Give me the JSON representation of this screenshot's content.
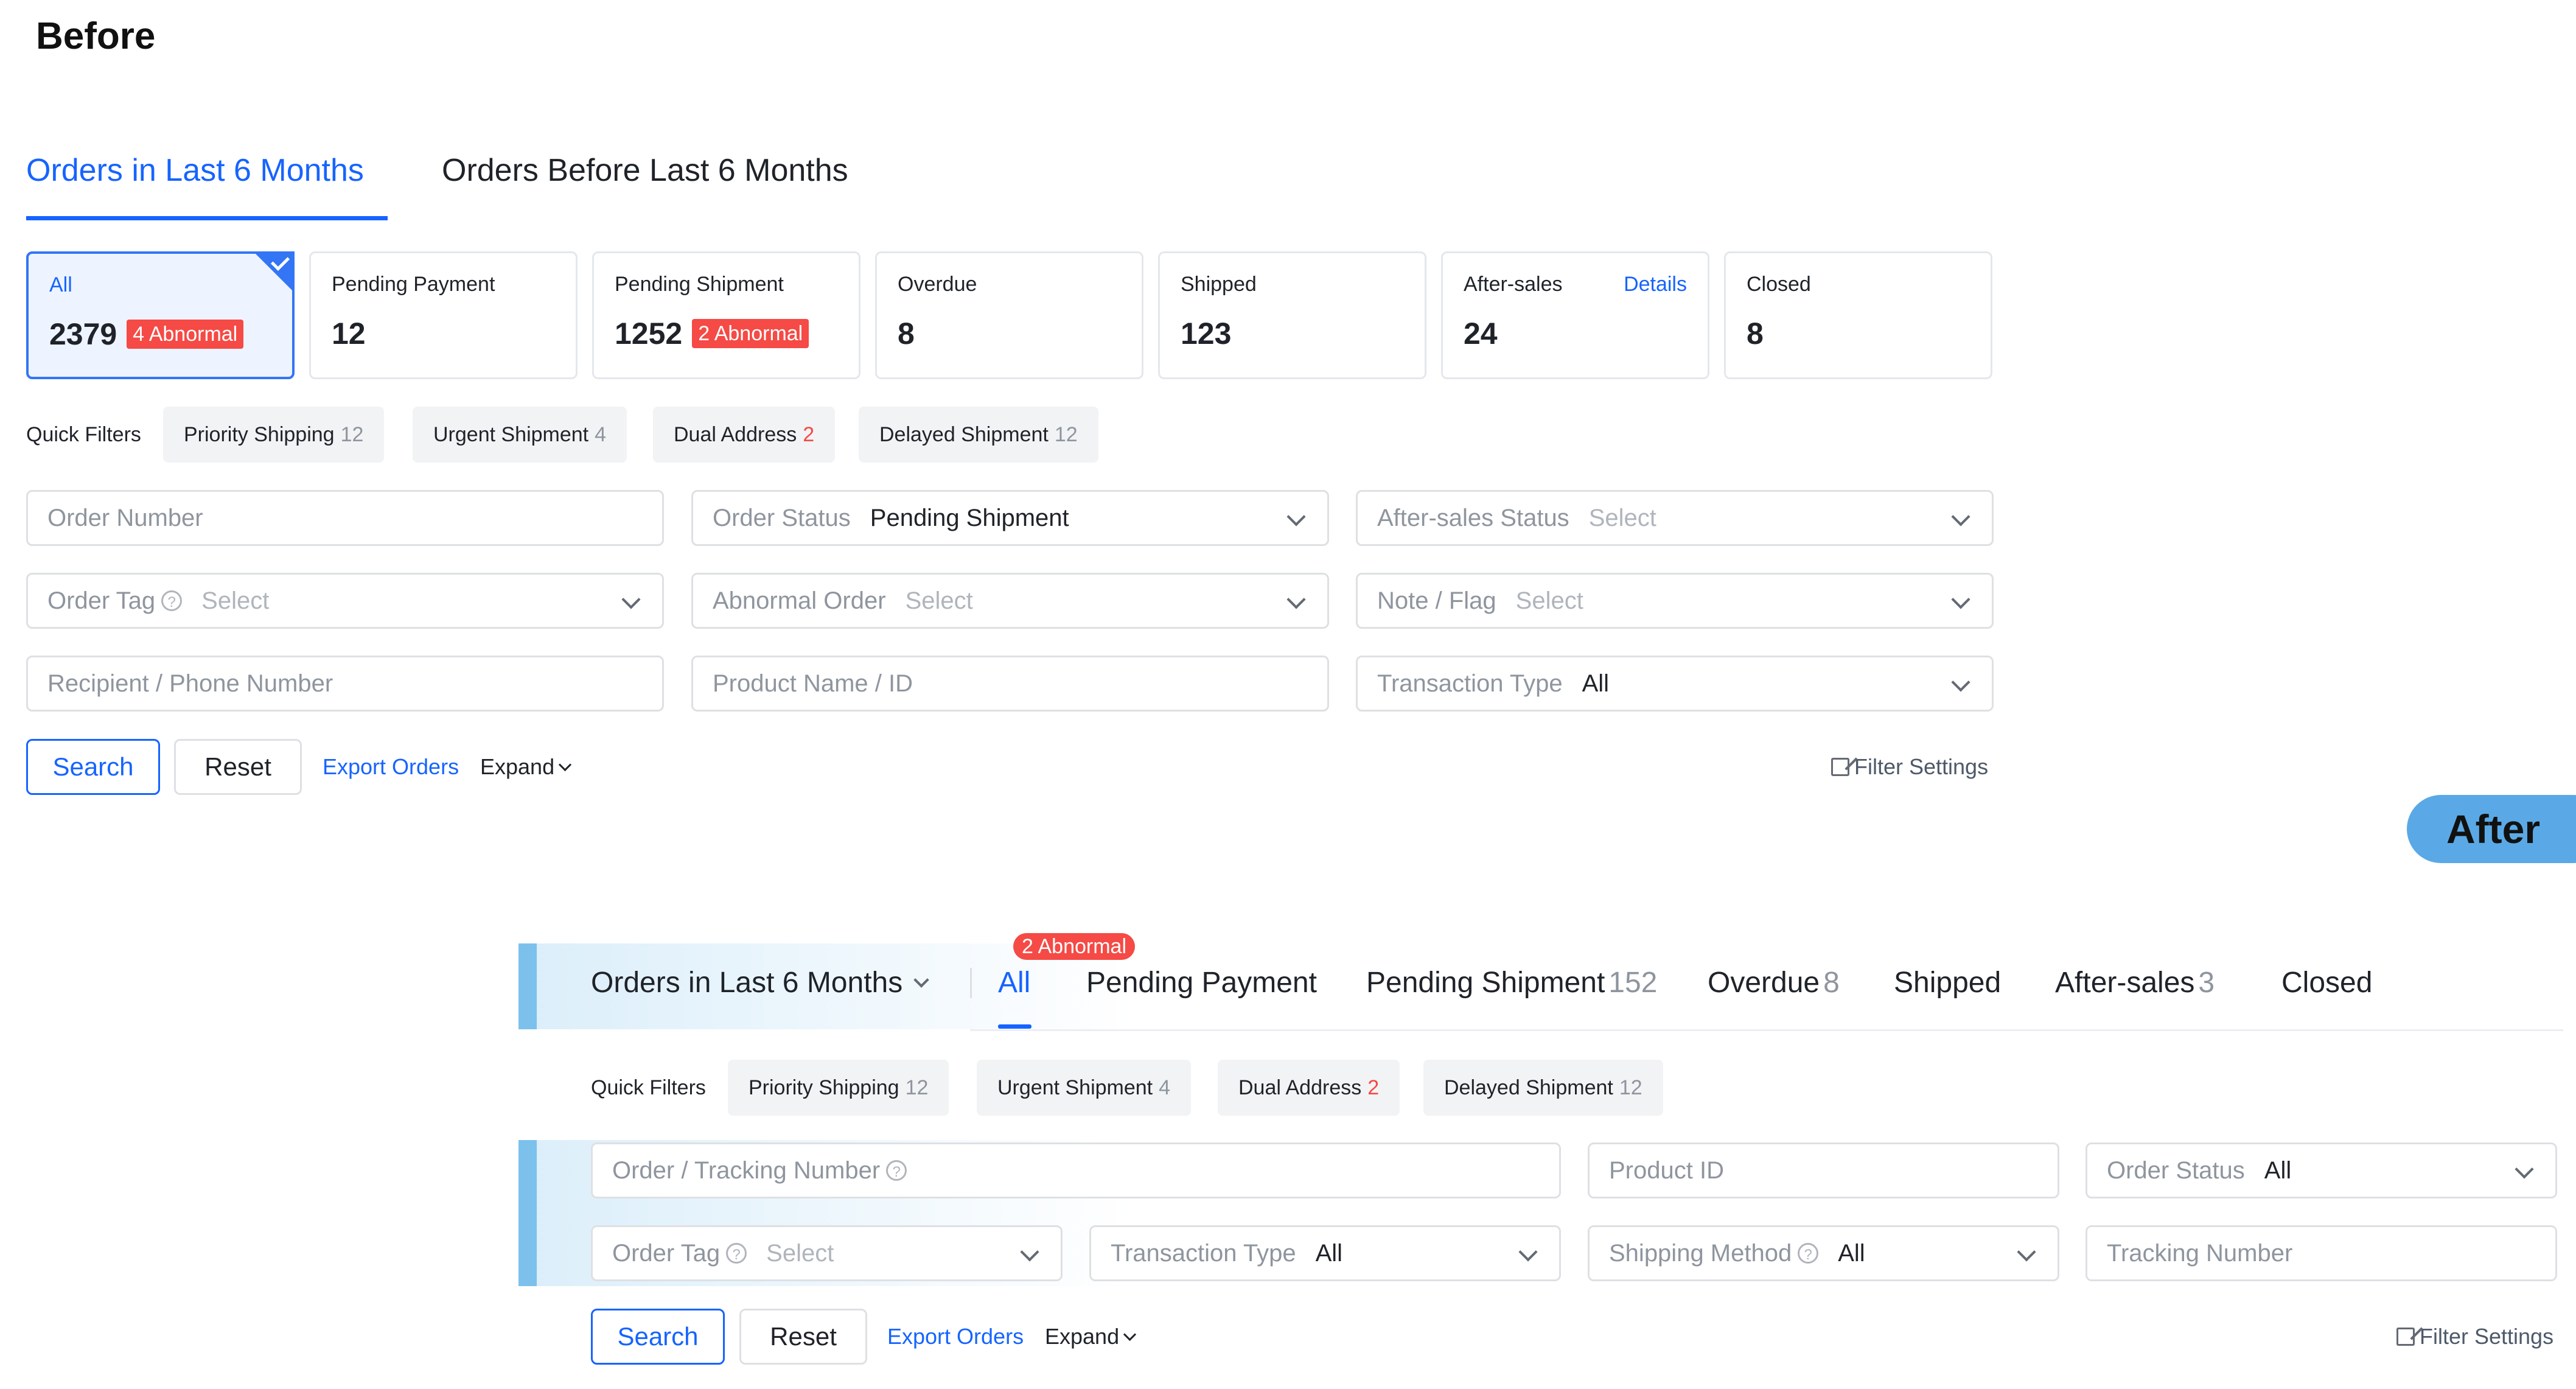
{
  "before": {
    "title": "Before",
    "tabs": [
      {
        "label": "Orders in Last 6 Months",
        "active": true
      },
      {
        "label": "Orders Before Last 6 Months",
        "active": false
      }
    ],
    "cards": [
      {
        "label": "All",
        "value": "2379",
        "badge": "4 Abnormal",
        "selected": true
      },
      {
        "label": "Pending Payment",
        "value": "12"
      },
      {
        "label": "Pending Shipment",
        "value": "1252",
        "badge": "2 Abnormal"
      },
      {
        "label": "Overdue",
        "value": "8"
      },
      {
        "label": "Shipped",
        "value": "123"
      },
      {
        "label": "After-sales",
        "value": "24",
        "link": "Details"
      },
      {
        "label": "Closed",
        "value": "8"
      }
    ],
    "quick_filters": {
      "label": "Quick Filters",
      "chips": [
        {
          "label": "Priority Shipping",
          "count": "12"
        },
        {
          "label": "Urgent Shipment",
          "count": "4"
        },
        {
          "label": "Dual Address",
          "count": "2"
        },
        {
          "label": "Delayed Shipment",
          "count": "12"
        }
      ]
    },
    "fields": {
      "order_number": {
        "placeholder": "Order Number"
      },
      "order_status": {
        "label": "Order Status",
        "value": "Pending Shipment"
      },
      "after_sales_status": {
        "label": "After-sales Status",
        "placeholder": "Select"
      },
      "order_tag": {
        "label": "Order Tag",
        "placeholder": "Select"
      },
      "abnormal_order": {
        "label": "Abnormal Order",
        "placeholder": "Select"
      },
      "note_flag": {
        "label": "Note / Flag",
        "placeholder": "Select"
      },
      "recipient_phone": {
        "placeholder": "Recipient / Phone Number"
      },
      "product_name_id": {
        "placeholder": "Product Name / ID"
      },
      "transaction_type": {
        "label": "Transaction Type",
        "value": "All"
      }
    },
    "actions": {
      "search": "Search",
      "reset": "Reset",
      "export": "Export Orders",
      "expand": "Expand",
      "filter_settings": "Filter Settings"
    }
  },
  "after": {
    "title": "After",
    "period_dropdown": "Orders in Last 6 Months",
    "abnormal_badge": "2 Abnormal",
    "tabs": [
      {
        "label": "All",
        "count": "",
        "active": true
      },
      {
        "label": "Pending Payment",
        "count": ""
      },
      {
        "label": "Pending Shipment",
        "count": "152"
      },
      {
        "label": "Overdue",
        "count": "8"
      },
      {
        "label": "Shipped",
        "count": ""
      },
      {
        "label": "After-sales",
        "count": "3"
      },
      {
        "label": "Closed",
        "count": ""
      }
    ],
    "quick_filters": {
      "label": "Quick Filters",
      "chips": [
        {
          "label": "Priority Shipping",
          "count": "12"
        },
        {
          "label": "Urgent Shipment",
          "count": "4"
        },
        {
          "label": "Dual Address",
          "count": "2"
        },
        {
          "label": "Delayed Shipment",
          "count": "12"
        }
      ]
    },
    "fields": {
      "order_tracking": {
        "placeholder": "Order / Tracking Number"
      },
      "product_id": {
        "placeholder": "Product ID"
      },
      "order_status": {
        "label": "Order Status",
        "value": "All"
      },
      "order_tag": {
        "label": "Order Tag",
        "placeholder": "Select"
      },
      "transaction_type": {
        "label": "Transaction Type",
        "value": "All"
      },
      "shipping_method": {
        "label": "Shipping Method",
        "value": "All"
      },
      "tracking_number": {
        "placeholder": "Tracking Number"
      }
    },
    "actions": {
      "search": "Search",
      "reset": "Reset",
      "export": "Export Orders",
      "expand": "Expand",
      "filter_settings": "Filter Settings"
    }
  },
  "colors": {
    "accent": "#1664ff",
    "danger": "#f54a45",
    "after_pill": "#5aa9e6",
    "after_bar": "#7cc1ec"
  }
}
